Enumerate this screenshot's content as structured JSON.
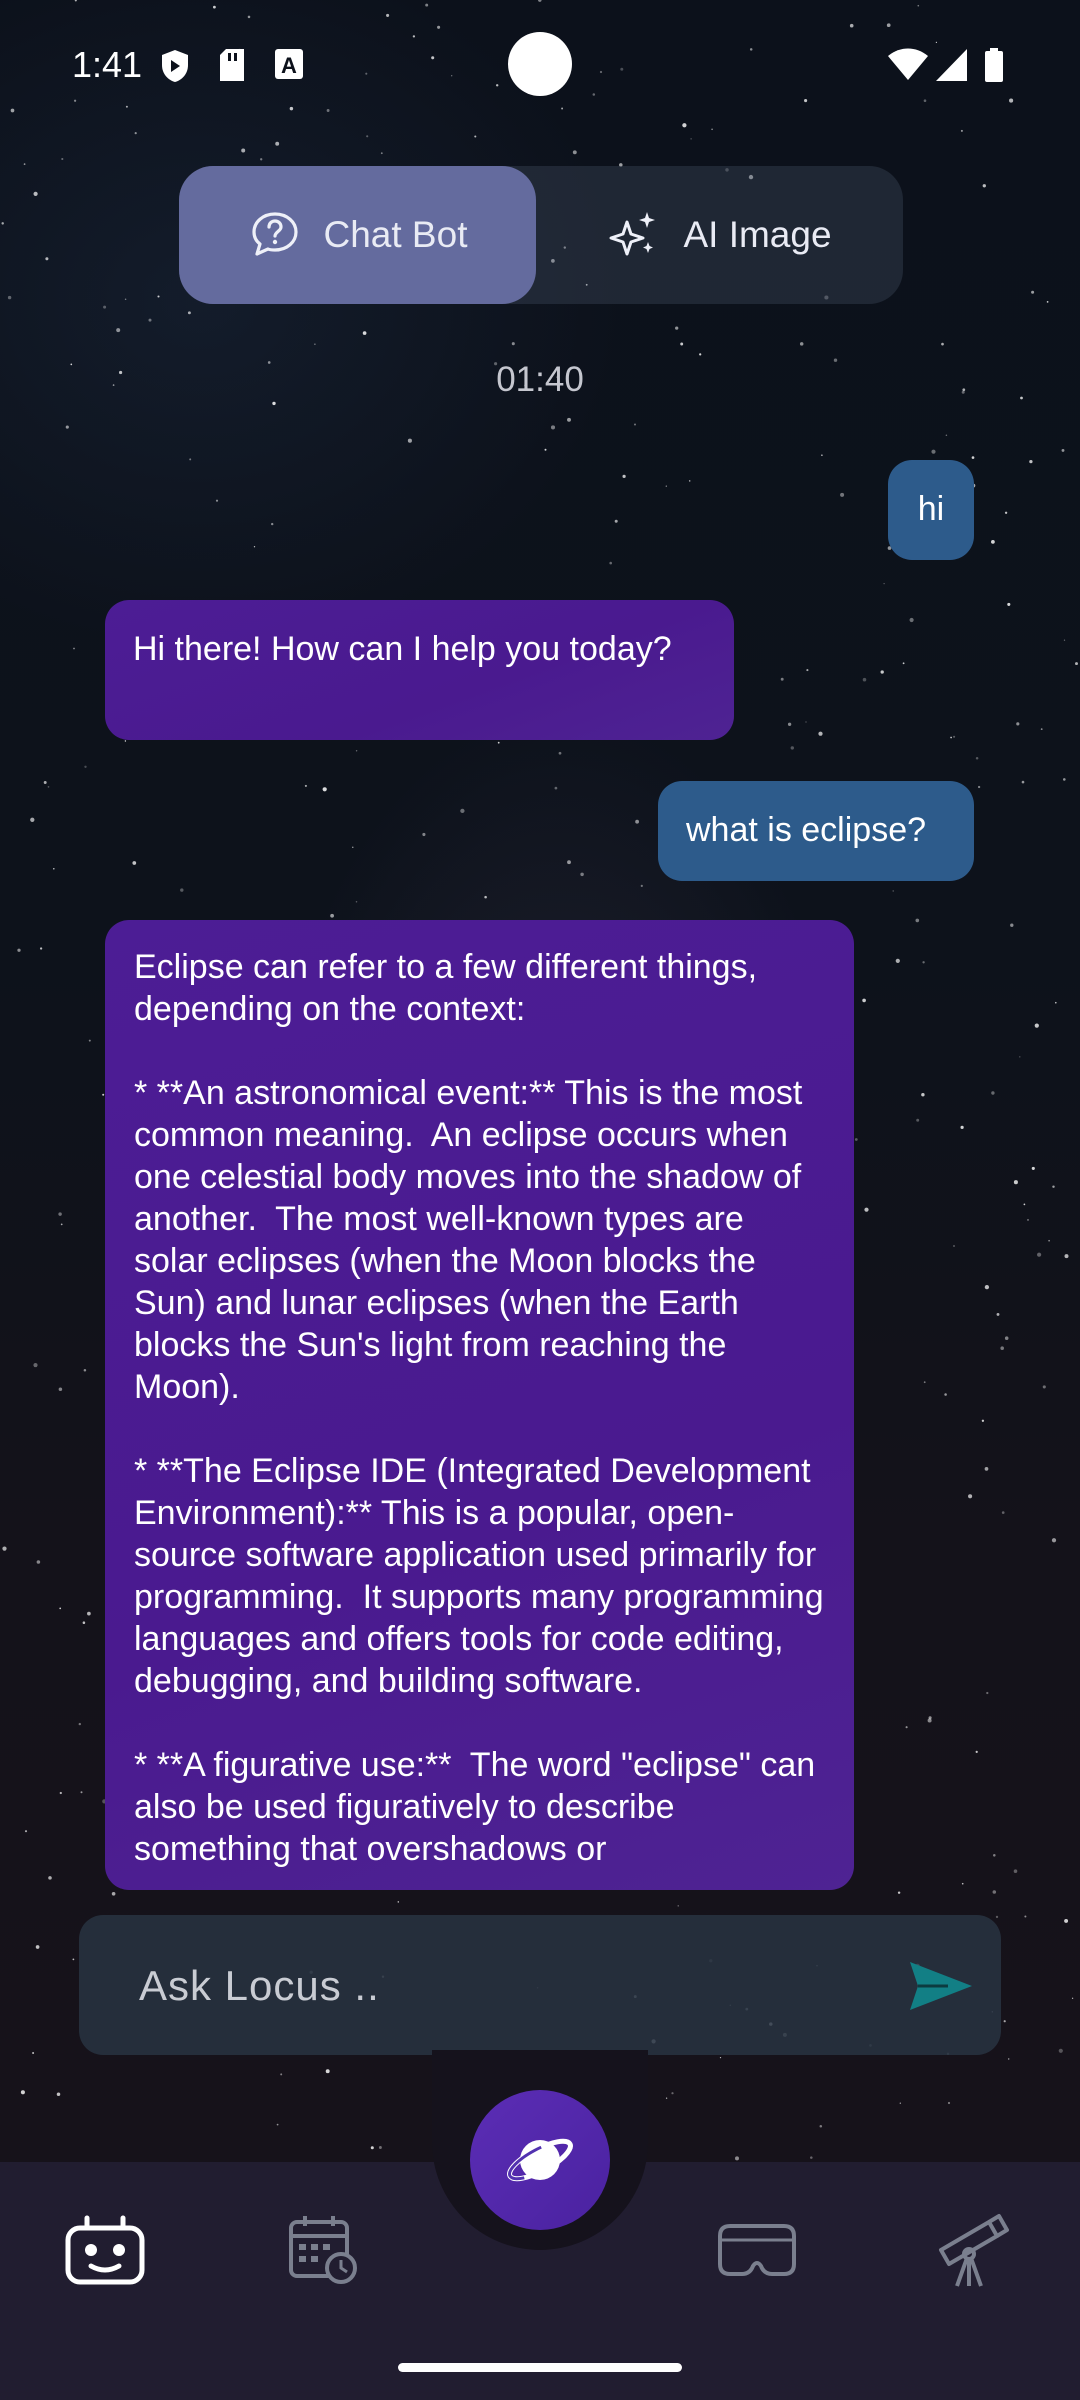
{
  "status_bar": {
    "time": "1:41",
    "icons": [
      "shield-icon",
      "sd-card-icon",
      "text-a-icon",
      "wifi-icon",
      "signal-icon",
      "battery-icon"
    ]
  },
  "toggle": {
    "chat_label": "Chat Bot",
    "image_label": "AI Image",
    "selected": "Chat Bot"
  },
  "chat": {
    "timestamp": "01:40",
    "messages": [
      {
        "role": "user",
        "text": "hi"
      },
      {
        "role": "bot",
        "text": "Hi there! How can I help you today?"
      },
      {
        "role": "user",
        "text": "what is eclipse?"
      },
      {
        "role": "bot",
        "text": "Eclipse can refer to a few different things, depending on the context:\n\n* **An astronomical event:** This is the most common meaning.  An eclipse occurs when one celestial body moves into the shadow of another.  The most well-known types are solar eclipses (when the Moon blocks the Sun) and lunar eclipses (when the Earth blocks the Sun's light from reaching the Moon).\n\n* **The Eclipse IDE (Integrated Development Environment):** This is a popular, open-source software application used primarily for programming.  It supports many programming languages and offers tools for code editing, debugging, and building software.\n\n* **A figurative use:**  The word \"eclipse\" can also be used figuratively to describe something that overshadows or"
      }
    ]
  },
  "input": {
    "placeholder": "Ask Locus .."
  },
  "nav": {
    "items": [
      "robot-icon",
      "calendar-clock-icon",
      "planet-icon",
      "vr-headset-icon",
      "telescope-icon"
    ],
    "active": "robot-icon"
  },
  "colors": {
    "accent": "#646b9e",
    "user_bubble": "#2d5b8b",
    "bot_bubble": "#4c1d95",
    "send": "#127f85",
    "nav_bg": "#211d30"
  }
}
